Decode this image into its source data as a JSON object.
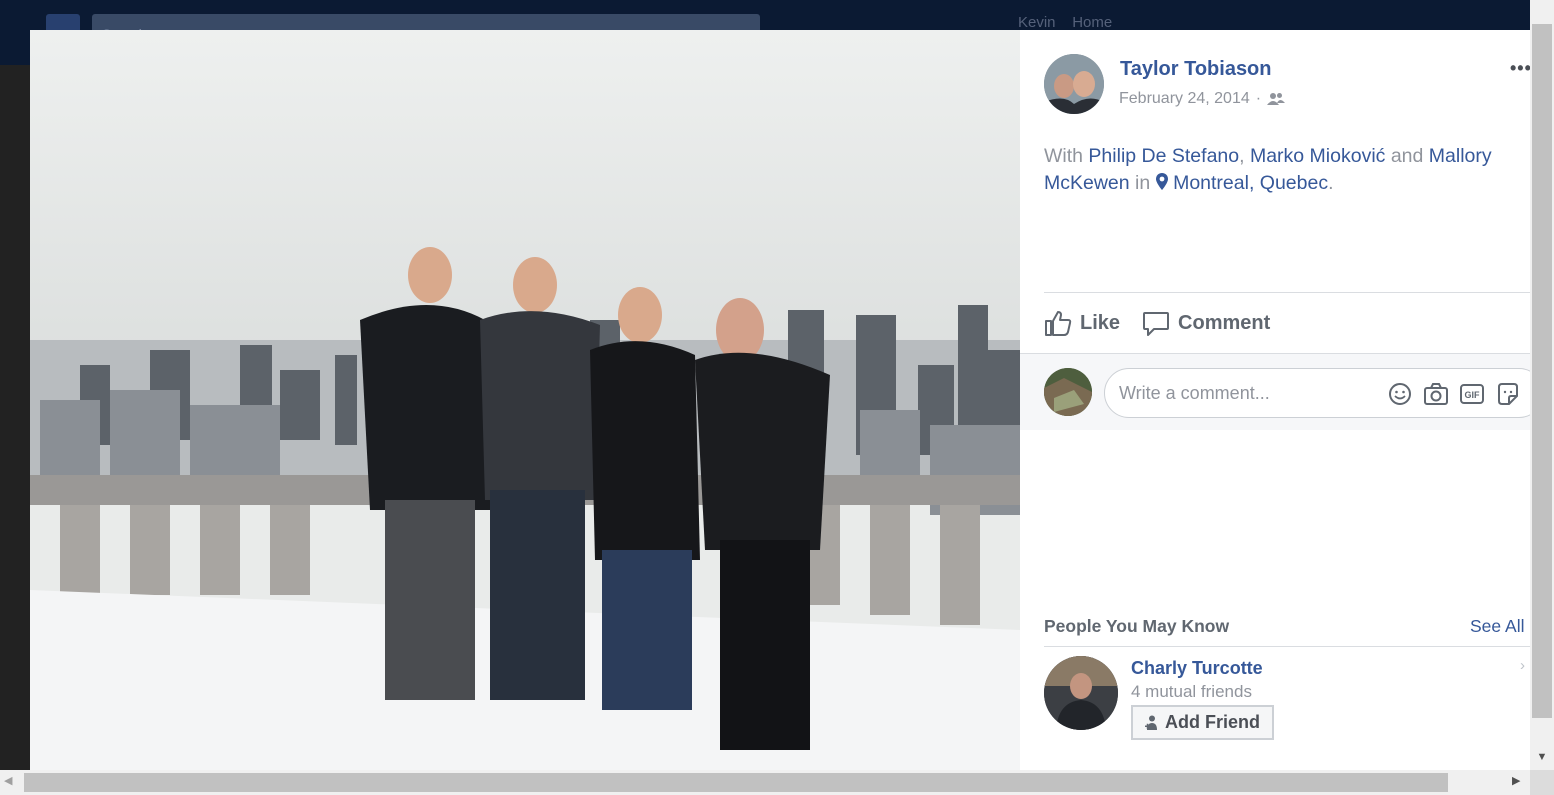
{
  "background": {
    "search_placeholder": "Search",
    "user_name": "Kevin",
    "home_label": "Home"
  },
  "post": {
    "author": "Taylor Tobiason",
    "date": "February 24, 2014",
    "date_separator": "·",
    "audience_icon": "friends-icon",
    "more_label": "•••",
    "with_prefix": "With",
    "tagged": [
      "Philip De Stefano",
      "Marko Mioković",
      "Mallory McKewen"
    ],
    "comma": ",",
    "and_word": "and",
    "in_word": "in",
    "location": "Montreal, Quebec",
    "period": "."
  },
  "actions": {
    "like_label": "Like",
    "comment_label": "Comment"
  },
  "comment": {
    "placeholder": "Write a comment...",
    "icons": [
      "emoji-icon",
      "camera-icon",
      "gif-icon",
      "sticker-icon"
    ],
    "gif_text": "GIF"
  },
  "pymk": {
    "title": "People You May Know",
    "see_all": "See All",
    "person": {
      "name": "Charly Turcotte",
      "mutual": "4 mutual friends",
      "add_label": "Add Friend"
    }
  },
  "colors": {
    "link": "#365899",
    "muted": "#90949c",
    "action": "#606770"
  }
}
